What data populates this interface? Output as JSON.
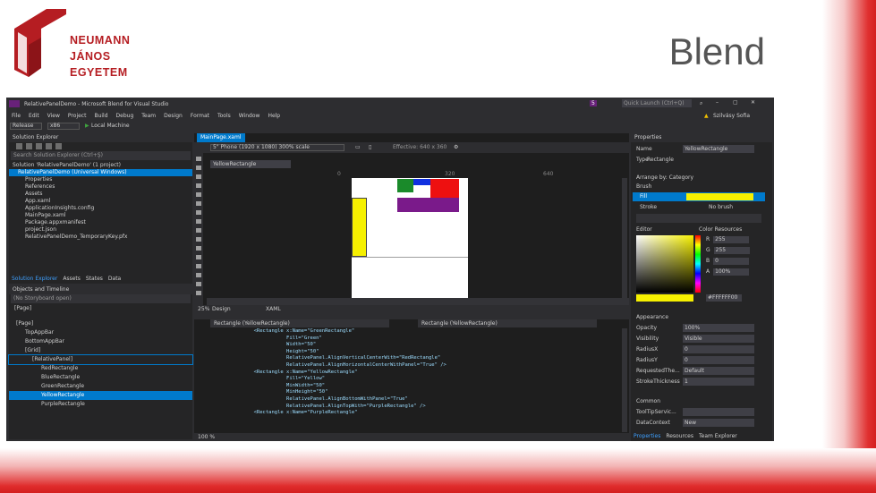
{
  "slide": {
    "university_lines": [
      "NEUMANN",
      "JÁNOS",
      "EGYETEM"
    ],
    "title": "Blend"
  },
  "window": {
    "title": "RelativePanelDemo - Microsoft Blend for Visual Studio",
    "quick_launch": "Quick Launch (Ctrl+Q)",
    "notification_count": "5",
    "user": "Szilvásy Sofia",
    "menu": [
      "File",
      "Edit",
      "View",
      "Project",
      "Build",
      "Debug",
      "Team",
      "Design",
      "Format",
      "Tools",
      "Window",
      "Help"
    ],
    "toolbar": {
      "config": "Release",
      "platform": "x86",
      "run_target": "Local Machine"
    }
  },
  "solution_explorer": {
    "header": "Solution Explorer",
    "search": "Search Solution Explorer (Ctrl+Ş)",
    "items": [
      "Solution 'RelativePanelDemo' (1 project)",
      "RelativePanelDemo (Universal Windows)",
      "Properties",
      "References",
      "Assets",
      "App.xaml",
      "ApplicationInsights.config",
      "MainPage.xaml",
      "Package.appxmanifest",
      "project.json",
      "RelativePanelDemo_TemporaryKey.pfx"
    ],
    "tabs": [
      "Solution Explorer",
      "Assets",
      "States",
      "Data"
    ]
  },
  "objects": {
    "header": "Objects and Timeline",
    "storyboard": "(No Storyboard open)",
    "page": "[Page]",
    "items": [
      "[Page]",
      "TopAppBar",
      "BottomAppBar",
      "[Grid]",
      "[RelativePanel]",
      "RedRectangle",
      "BlueRectangle",
      "GreenRectangle",
      "YellowRectangle",
      "PurpleRectangle"
    ]
  },
  "designer": {
    "tab": "MainPage.xaml",
    "device": "5\" Phone (1920 x 1080) 300% scale",
    "effective": "Effective: 640 x 360",
    "breadcrumb": "YellowRectangle",
    "ruler": [
      "0",
      "320",
      "640"
    ],
    "zoom": "25%",
    "tabs": [
      "Design",
      "XAML"
    ],
    "colors": {
      "green": "#1a8a2a",
      "blue": "#1030e0",
      "red": "#ee1010",
      "purple": "#7a1a8a",
      "yellow": "#f6f000"
    }
  },
  "xaml": {
    "left_dropdown": "Rectangle (YellowRectangle)",
    "right_dropdown": "Rectangle (YellowRectangle)",
    "zoom": "100 %",
    "lines": [
      "  <Rectangle x:Name=\"GreenRectangle\"",
      "             Fill=\"Green\"",
      "             Width=\"50\"",
      "             Height=\"50\"",
      "             RelativePanel.AlignVerticalCenterWith=\"RedRectangle\"",
      "             RelativePanel.AlignHorizontalCenterWithPanel=\"True\" />",
      "",
      "  <Rectangle x:Name=\"YellowRectangle\"",
      "             Fill=\"Yellow\"",
      "             MinWidth=\"50\"",
      "             MinHeight=\"50\"",
      "             RelativePanel.AlignBottomWithPanel=\"True\"",
      "             RelativePanel.AlignTopWith=\"PurpleRectangle\" />",
      "",
      "  <Rectangle x:Name=\"PurpleRectangle\""
    ]
  },
  "properties": {
    "header": "Properties",
    "name_label": "Name",
    "name_value": "YellowRectangle",
    "type_label": "Type",
    "type_value": "Rectangle",
    "arrange": "Arrange by: Category",
    "brush_section": "Brush",
    "fill_label": "Fill",
    "stroke_label": "Stroke",
    "stroke_value": "No brush",
    "editor_label": "Editor",
    "color_resources": "Color Resources",
    "rgba": [
      {
        "label": "R",
        "value": "255"
      },
      {
        "label": "G",
        "value": "255"
      },
      {
        "label": "B",
        "value": "0"
      },
      {
        "label": "A",
        "value": "100%"
      }
    ],
    "hex": "#FFFFFF00",
    "appearance_section": "Appearance",
    "appearance": [
      {
        "label": "Opacity",
        "value": "100%"
      },
      {
        "label": "Visibility",
        "value": "Visible"
      },
      {
        "label": "RadiusX",
        "value": "0"
      },
      {
        "label": "RadiusY",
        "value": "0"
      },
      {
        "label": "RequestedThe...",
        "value": "Default"
      },
      {
        "label": "StrokeThickness",
        "value": "1"
      }
    ],
    "common_section": "Common",
    "common": [
      {
        "label": "ToolTipServic...",
        "value": ""
      },
      {
        "label": "DataContext",
        "value": "New"
      }
    ],
    "bottom_tabs": [
      "Properties",
      "Resources",
      "Team Explorer"
    ]
  }
}
